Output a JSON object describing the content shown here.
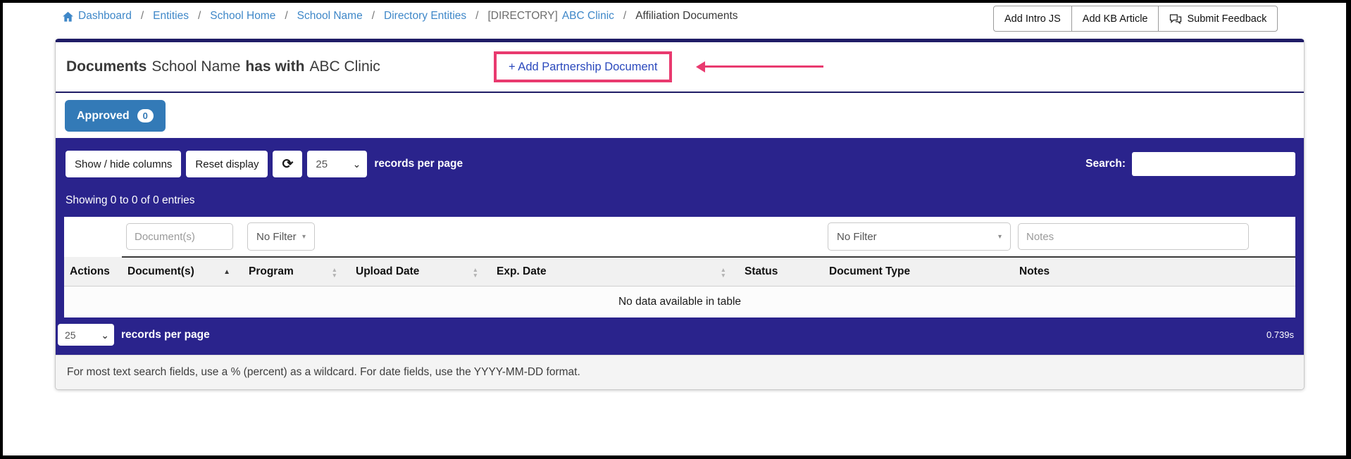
{
  "breadcrumb": {
    "separator": "/",
    "links": [
      "Dashboard",
      "Entities",
      "School Home",
      "School Name",
      "Directory Entities"
    ],
    "directory_tag": "[DIRECTORY]",
    "directory_name": "ABC Clinic",
    "current": "Affiliation Documents"
  },
  "header_buttons": {
    "add_intro": "Add Intro JS",
    "add_kb": "Add KB Article",
    "feedback": "Submit Feedback"
  },
  "panel": {
    "title": {
      "prefix": "Documents",
      "school": "School Name",
      "middle": "has with",
      "entity": "ABC Clinic"
    },
    "add_link": "+ Add Partnership Document",
    "tab": {
      "label": "Approved",
      "count": "0"
    }
  },
  "toolbar": {
    "show_hide": "Show / hide columns",
    "reset": "Reset display",
    "page_size": "25",
    "records_label": "records per page",
    "search_label": "Search:"
  },
  "status": {
    "showing": "Showing 0 to 0 of 0 entries"
  },
  "table": {
    "filters": {
      "documents_placeholder": "Document(s)",
      "program_filter": "No Filter",
      "doctype_filter": "No Filter",
      "notes_placeholder": "Notes"
    },
    "columns": [
      {
        "label": "Actions",
        "sort": "none"
      },
      {
        "label": "Document(s)",
        "sort": "asc"
      },
      {
        "label": "Program",
        "sort": "both"
      },
      {
        "label": "Upload Date",
        "sort": "both"
      },
      {
        "label": "Exp. Date",
        "sort": "both"
      },
      {
        "label": "Status",
        "sort": "none"
      },
      {
        "label": "Document Type",
        "sort": "none"
      },
      {
        "label": "Notes",
        "sort": "none"
      }
    ],
    "empty_message": "No data available in table"
  },
  "pagination": {
    "page_size": "25",
    "records_label": "records per page",
    "timing": "0.739s"
  },
  "footer_note": "For most text search fields, use a % (percent) as a wildcard. For date fields, use the YYYY-MM-DD format.",
  "icons": {
    "sort_asc": "▲",
    "sort_desc": "▼",
    "refresh": "⟳",
    "select_caret": "⌄",
    "filter_caret": "▾"
  },
  "colors": {
    "navy": "#2A238C",
    "panel_border_navy": "#1f1c66",
    "approved_blue": "#337ab7",
    "breadcrumb_blue": "#3e87c8",
    "add_link_blue": "#2b49bd",
    "annotation_pink": "#e93a6f"
  }
}
